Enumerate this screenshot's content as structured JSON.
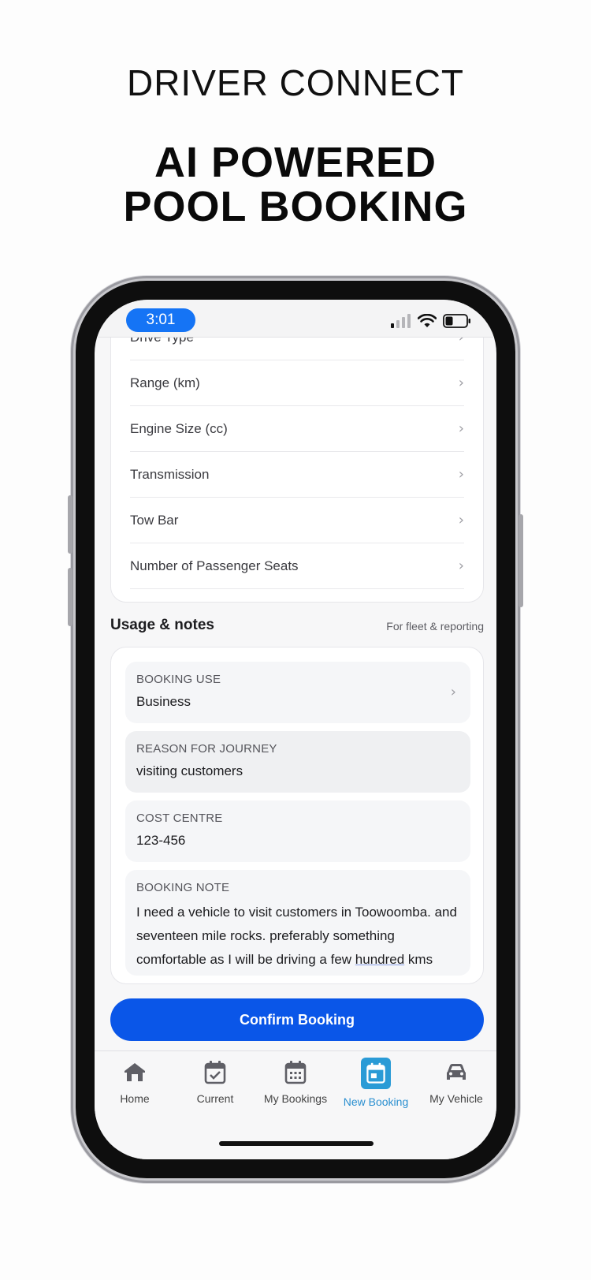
{
  "hero": {
    "brand": "DRIVER CONNECT",
    "title_line1": "AI POWERED",
    "title_line2": "POOL BOOKING"
  },
  "status_bar": {
    "time": "3:01",
    "accent_color": "#1574f5"
  },
  "specs": {
    "rows": [
      "Drive Type",
      "Range (km)",
      "Engine Size (cc)",
      "Transmission",
      "Tow Bar",
      "Number of Passenger Seats"
    ]
  },
  "usage": {
    "title": "Usage & notes",
    "subtitle": "For fleet & reporting",
    "fields": {
      "booking_use": {
        "label": "BOOKING USE",
        "value": "Business"
      },
      "reason": {
        "label": "REASON FOR JOURNEY",
        "value": "visiting customers"
      },
      "cost_centre": {
        "label": "COST CENTRE",
        "value": "123-456"
      },
      "note": {
        "label": "BOOKING NOTE",
        "value_before": "I need a vehicle to visit customers in Toowoomba. and seventeen mile rocks. preferably something comfortable as I will be driving a few ",
        "value_underlined": "hundred",
        "value_after": " kms"
      }
    }
  },
  "confirm_button": {
    "label": "Confirm Booking",
    "color": "#0a56e8"
  },
  "tab_bar": {
    "active_color": "#2a8fd0",
    "tabs": [
      {
        "label": "Home",
        "icon": "home-icon"
      },
      {
        "label": "Current",
        "icon": "calendar-check-icon"
      },
      {
        "label": "My Bookings",
        "icon": "calendar-grid-icon"
      },
      {
        "label": "New Booking",
        "icon": "calendar-new-icon",
        "active": true
      },
      {
        "label": "My Vehicle",
        "icon": "car-icon"
      }
    ]
  }
}
